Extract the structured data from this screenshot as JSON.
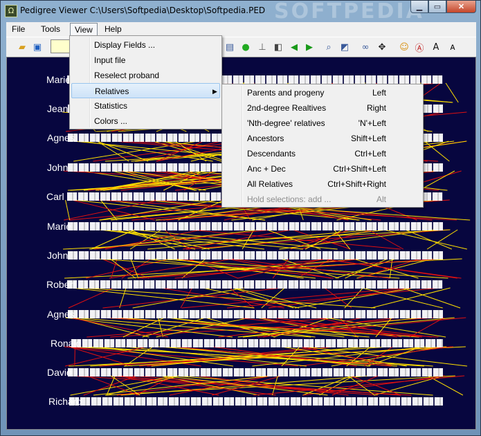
{
  "window": {
    "title": "Pedigree Viewer  C:\\Users\\Softpedia\\Desktop\\Softpedia.PED",
    "watermark": "SOFTPEDIA"
  },
  "menubar": [
    "File",
    "Tools",
    "View",
    "Help"
  ],
  "view_menu": {
    "items": [
      "Display Fields ...",
      "Input file",
      "Reselect proband",
      "Relatives",
      "Statistics",
      "Colors ..."
    ],
    "highlighted": "Relatives"
  },
  "relatives_submenu": [
    {
      "label": "Parents and progeny",
      "shortcut": "Left",
      "enabled": true
    },
    {
      "label": "2nd-degree Realtives",
      "shortcut": "Right",
      "enabled": true
    },
    {
      "label": "'Nth-degree' relatives",
      "shortcut": "'N'+Left",
      "enabled": true
    },
    {
      "label": "Ancestors",
      "shortcut": "Shift+Left",
      "enabled": true
    },
    {
      "label": "Descendants",
      "shortcut": "Ctrl+Left",
      "enabled": true
    },
    {
      "label": "Anc + Dec",
      "shortcut": "Ctrl+Shift+Left",
      "enabled": true
    },
    {
      "label": "All Relatives",
      "shortcut": "Ctrl+Shift+Right",
      "enabled": true
    },
    {
      "label": "Hold selections: add ...",
      "shortcut": "Alt",
      "enabled": false
    }
  ],
  "toolbar_icons": [
    "open-folder-icon",
    "window-icon",
    "print-icon",
    "check-icon",
    "tree-icon",
    "gradient-icon",
    "left-arrow-icon",
    "right-arrow-icon",
    "zoom-icon",
    "find-icon",
    "binoculars-icon",
    "move-icon",
    "smiley-icon",
    "font-color-icon",
    "font-grow-icon",
    "font-shrink-icon"
  ],
  "pedigree_rows": [
    {
      "label": "Marie"
    },
    {
      "label": "Jean"
    },
    {
      "label": "Agnes"
    },
    {
      "label": "John"
    },
    {
      "label": "Carl"
    },
    {
      "label": "Marie"
    },
    {
      "label": "John"
    },
    {
      "label": "Robert"
    },
    {
      "label": "Agnes"
    },
    {
      "label": "Ronald"
    },
    {
      "label": "David"
    },
    {
      "label": "Richard"
    }
  ],
  "colors": {
    "canvas_bg": "#07063f",
    "line_yellow": "#ffe000",
    "line_red": "#e01010",
    "label": "#ffffff"
  }
}
